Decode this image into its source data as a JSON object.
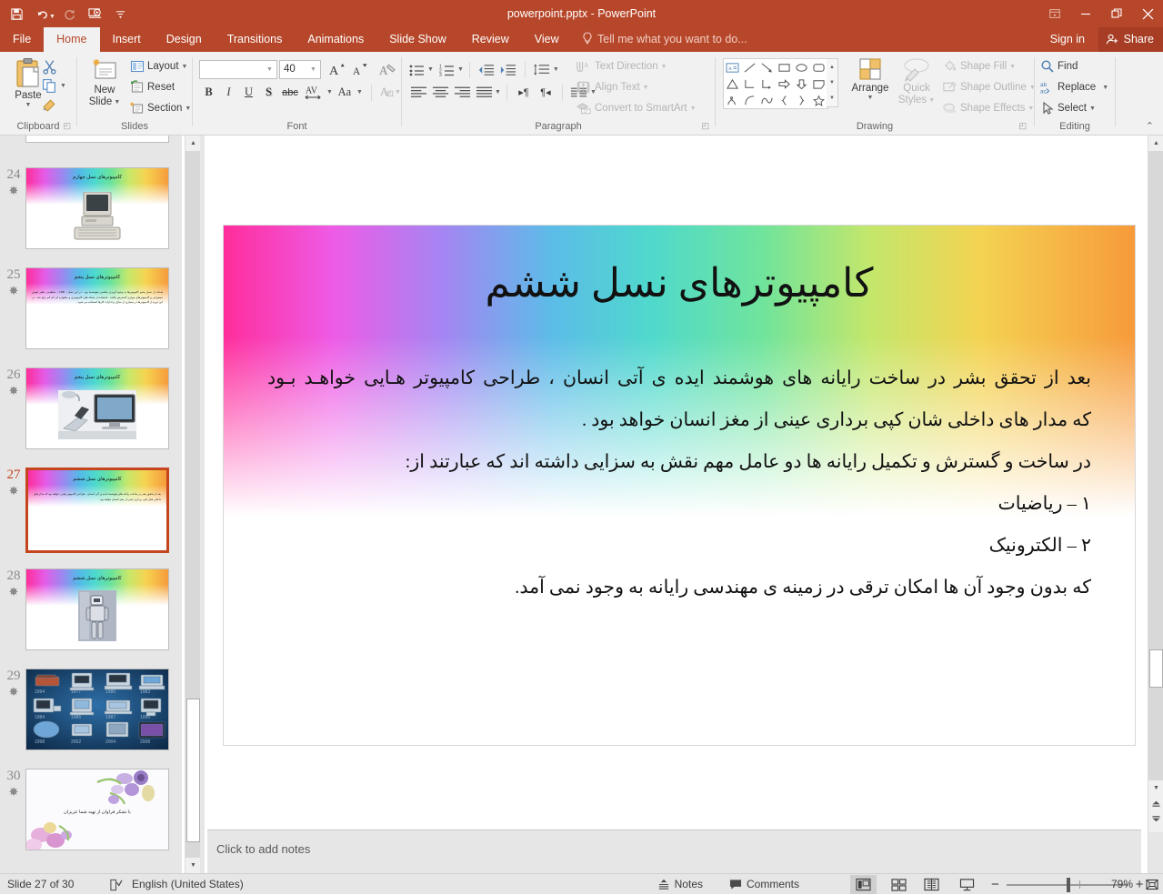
{
  "window": {
    "title": "powerpoint.pptx - PowerPoint",
    "quick_access": [
      "save-icon",
      "undo-icon",
      "redo-icon",
      "start-slideshow-icon",
      "customize-qat-icon"
    ],
    "controls": [
      "ribbon-display-options-icon",
      "minimize-icon",
      "restore-icon",
      "close-icon"
    ],
    "accent_color": "#B7472A"
  },
  "tabs": [
    {
      "label": "File",
      "active": false
    },
    {
      "label": "Home",
      "active": true
    },
    {
      "label": "Insert",
      "active": false
    },
    {
      "label": "Design",
      "active": false
    },
    {
      "label": "Transitions",
      "active": false
    },
    {
      "label": "Animations",
      "active": false
    },
    {
      "label": "Slide Show",
      "active": false
    },
    {
      "label": "Review",
      "active": false
    },
    {
      "label": "View",
      "active": false
    }
  ],
  "tell_me": "Tell me what you want to do...",
  "sign_in": "Sign in",
  "share": "Share",
  "ribbon": {
    "groups": [
      {
        "name": "Clipboard",
        "label": "Clipboard"
      },
      {
        "name": "Slides",
        "label": "Slides"
      },
      {
        "name": "Font",
        "label": "Font"
      },
      {
        "name": "Paragraph",
        "label": "Paragraph"
      },
      {
        "name": "Drawing",
        "label": "Drawing"
      },
      {
        "name": "Editing",
        "label": "Editing"
      }
    ],
    "clipboard": {
      "paste": "Paste",
      "cut": "cut-icon",
      "copy": "copy-icon",
      "format_painter": "format-painter-icon"
    },
    "slides": {
      "new_slide": "New\nSlide",
      "new_slide_line1": "New",
      "new_slide_line2": "Slide",
      "layout": "Layout",
      "reset": "Reset",
      "section": "Section"
    },
    "font": {
      "font_name": "",
      "font_name_placeholder": "",
      "font_size": "40",
      "grow": "increase-font-size-icon",
      "shrink": "decrease-font-size-icon",
      "clear_formatting": "clear-formatting-icon",
      "bold": "B",
      "italic": "I",
      "underline": "U",
      "shadow": "S",
      "strikethrough": "abc",
      "char_spacing": "AV",
      "change_case": "Aa",
      "font_color": "A"
    },
    "paragraph": {
      "text_direction": "Text Direction",
      "align_text": "Align Text",
      "convert_smartart": "Convert to SmartArt"
    },
    "drawing": {
      "arrange": "Arrange",
      "quick_styles_l1": "Quick",
      "quick_styles_l2": "Styles",
      "shape_fill": "Shape Fill",
      "shape_outline": "Shape Outline",
      "shape_effects": "Shape Effects"
    },
    "editing": {
      "find": "Find",
      "replace": "Replace",
      "select": "Select"
    }
  },
  "thumbnails": [
    {
      "number": "23",
      "title": "",
      "body": "",
      "selected": false,
      "kind": "blank",
      "partial": true
    },
    {
      "number": "24",
      "title": "کامپیوترهای نسل چهارم",
      "body": "",
      "selected": false,
      "kind": "image-crt"
    },
    {
      "number": "25",
      "title": "کامپیوترهای نسل پنجم",
      "body": "هـدف از نسل پنجم كامپیوترها به وجود آوردن ماشینی هوشمند بود . در این نسل - 1990 - مفاهیمی نظیر هوش مصنوعی و كامپیوترهای موازی گسترش یافتند . استفاده از شبكه های كامپیوتری و ماهواره ای كم كم رایج شد . در این دوره از کامپیوترها در بسیاری از منازل و ادارات كارها استفاده می شود .",
      "selected": false,
      "kind": "text"
    },
    {
      "number": "26",
      "title": "کامپیوترهای نسل پنجم",
      "body": "",
      "selected": false,
      "kind": "image-desk"
    },
    {
      "number": "27",
      "title": "کامپیوترهای نسل ششم",
      "body": "بعد از تحقق بشر در ساخت رایانه های هوشمند ایده ی آتی انسان ، طراحی کامپیوتر هایی خواهد بود که مدار های داخلی شان کپی برداری عینی از مغز انسان خواهد بود .",
      "selected": true,
      "kind": "text"
    },
    {
      "number": "28",
      "title": "کامپیوترهای نسل ششم",
      "body": "",
      "selected": false,
      "kind": "image-robot"
    },
    {
      "number": "29",
      "title": "",
      "body": "",
      "selected": false,
      "kind": "image-timeline"
    },
    {
      "number": "30",
      "title": "با تشکر فراوان از تهیه شما عزیزان",
      "body": "",
      "selected": false,
      "kind": "image-flowers"
    }
  ],
  "slide": {
    "title": "کامپیوترهای نسل ششم",
    "paragraphs": [
      {
        "text": "بعد از تحقق بشر در ساخت رایانه های هوشمند ایده ی آتی انسان ، طراحی کامپیوتر هـایی خواهـد بـود",
        "align": "justify"
      },
      {
        "text": "که مدار های داخلی شان کپی برداری عینی از مغز انسان خواهد بود .",
        "align": "right"
      },
      {
        "text": "در ساخت و گسترش و تکمیل رایانه ها دو عامل مهم نقش به سزایی داشته اند که عبارتند از:",
        "align": "right"
      },
      {
        "text": "۱ – ریاضیات",
        "align": "right"
      },
      {
        "text": "۲ – الکترونیک",
        "align": "right"
      },
      {
        "text": "که بدون وجود آن ها امکان ترقی در زمینه ی مهندسی رایانه به وجود نمی آمد.",
        "align": "right"
      }
    ]
  },
  "notes": {
    "placeholder": "Click to add notes"
  },
  "status": {
    "slide_counter": "Slide 27 of 30",
    "spellcheck": "spellcheck-icon",
    "language": "English (United States)",
    "notes_button": "Notes",
    "comments_button": "Comments",
    "views": [
      "normal-view-icon",
      "slide-sorter-icon",
      "reading-view-icon",
      "slideshow-icon"
    ],
    "zoom_out": "−",
    "zoom_in": "+",
    "zoom_level": "79%",
    "fit_to_window": "fit-slide-icon"
  }
}
